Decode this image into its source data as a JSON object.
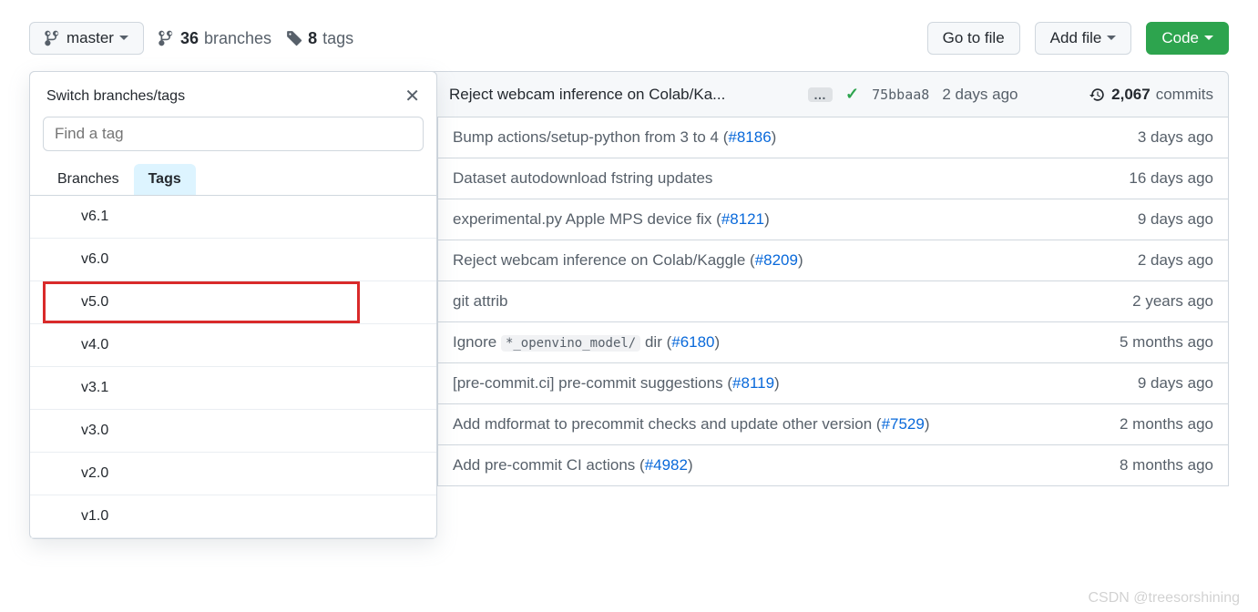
{
  "branch_selector": {
    "label": "master"
  },
  "meta": {
    "branches_count": "36",
    "branches_label": "branches",
    "tags_count": "8",
    "tags_label": "tags"
  },
  "actions": {
    "go_to_file": "Go to file",
    "add_file": "Add file",
    "code": "Code"
  },
  "header": {
    "commit_title": "Reject webcam inference on Colab/Ka...",
    "sha": "75bbaa8",
    "time": "2 days ago",
    "commits_count": "2,067",
    "commits_label": "commits"
  },
  "rows": [
    {
      "msg_pre": "Bump actions/setup-python from 3 to 4 (",
      "link": "#8186",
      "msg_post": ")",
      "time": "3 days ago"
    },
    {
      "msg_pre": "Dataset autodownload fstring updates",
      "link": "",
      "msg_post": "",
      "time": "16 days ago"
    },
    {
      "msg_pre": "experimental.py Apple MPS device fix (",
      "link": "#8121",
      "msg_post": ")",
      "time": "9 days ago"
    },
    {
      "msg_pre": "Reject webcam inference on Colab/Kaggle (",
      "link": "#8209",
      "msg_post": ")",
      "time": "2 days ago"
    },
    {
      "msg_pre": "git attrib",
      "link": "",
      "msg_post": "",
      "time": "2 years ago"
    },
    {
      "msg_pre": "Ignore ",
      "code": "*_openvino_model/",
      "mid": " dir (",
      "link": "#6180",
      "msg_post": ")",
      "time": "5 months ago"
    },
    {
      "msg_pre": "[pre-commit.ci] pre-commit suggestions (",
      "link": "#8119",
      "msg_post": ")",
      "time": "9 days ago"
    },
    {
      "msg_pre": "Add mdformat to precommit checks and update other version (",
      "link": "#7529",
      "msg_post": ")",
      "time": "2 months ago"
    },
    {
      "msg_pre": "Add pre-commit CI actions (",
      "link": "#4982",
      "msg_post": ")",
      "time": "8 months ago"
    }
  ],
  "popover": {
    "title": "Switch branches/tags",
    "search_placeholder": "Find a tag",
    "tab_branches": "Branches",
    "tab_tags": "Tags",
    "tags": [
      "v6.1",
      "v6.0",
      "v5.0",
      "v4.0",
      "v3.1",
      "v3.0",
      "v2.0",
      "v1.0"
    ],
    "highlighted_index": 2
  },
  "watermark": "CSDN @treesorshining"
}
